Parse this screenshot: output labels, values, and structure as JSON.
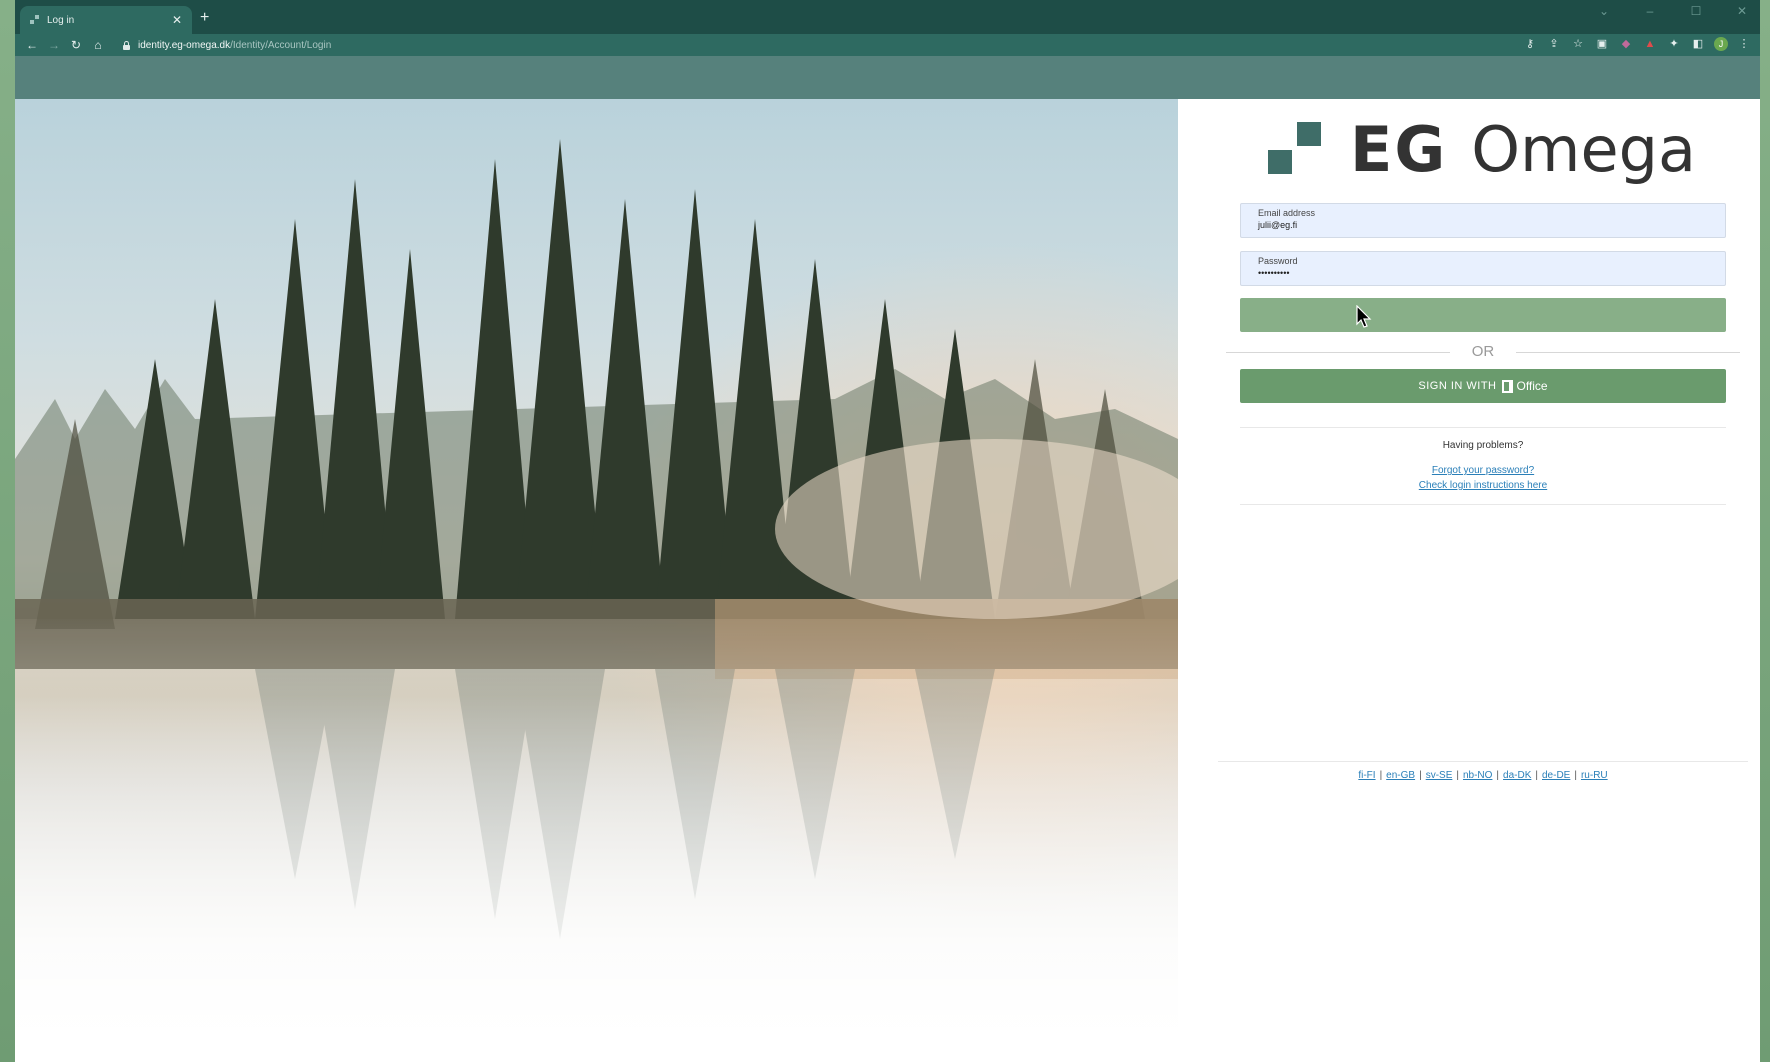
{
  "browser": {
    "tab_title": "Log in",
    "url_host": "identity.eg-omega.dk",
    "url_path": "/Identity/Account/Login",
    "avatar_initial": "J"
  },
  "logo": {
    "brand": "EG",
    "product": "Omega",
    "color": "#3f6d68"
  },
  "form": {
    "email_label": "Email address",
    "email_value": "julii@eg.fi",
    "password_label": "Password",
    "password_value": "••••••••••",
    "login_button_label": "",
    "or_text": "OR",
    "office_button_prefix": "SIGN IN WITH",
    "office_button_word": "Office"
  },
  "help": {
    "heading": "Having problems?",
    "forgot_link": "Forgot your password?",
    "check_link": "Check login instructions here"
  },
  "languages": [
    "fi-FI",
    "en-GB",
    "sv-SE",
    "nb-NO",
    "da-DK",
    "de-DE",
    "ru-RU"
  ],
  "colors": {
    "header_band": "#56817c",
    "tab_strip": "#1e4d47",
    "primary_button": "#88af88",
    "office_button": "#6a9b6d",
    "link": "#2a7fb8"
  }
}
